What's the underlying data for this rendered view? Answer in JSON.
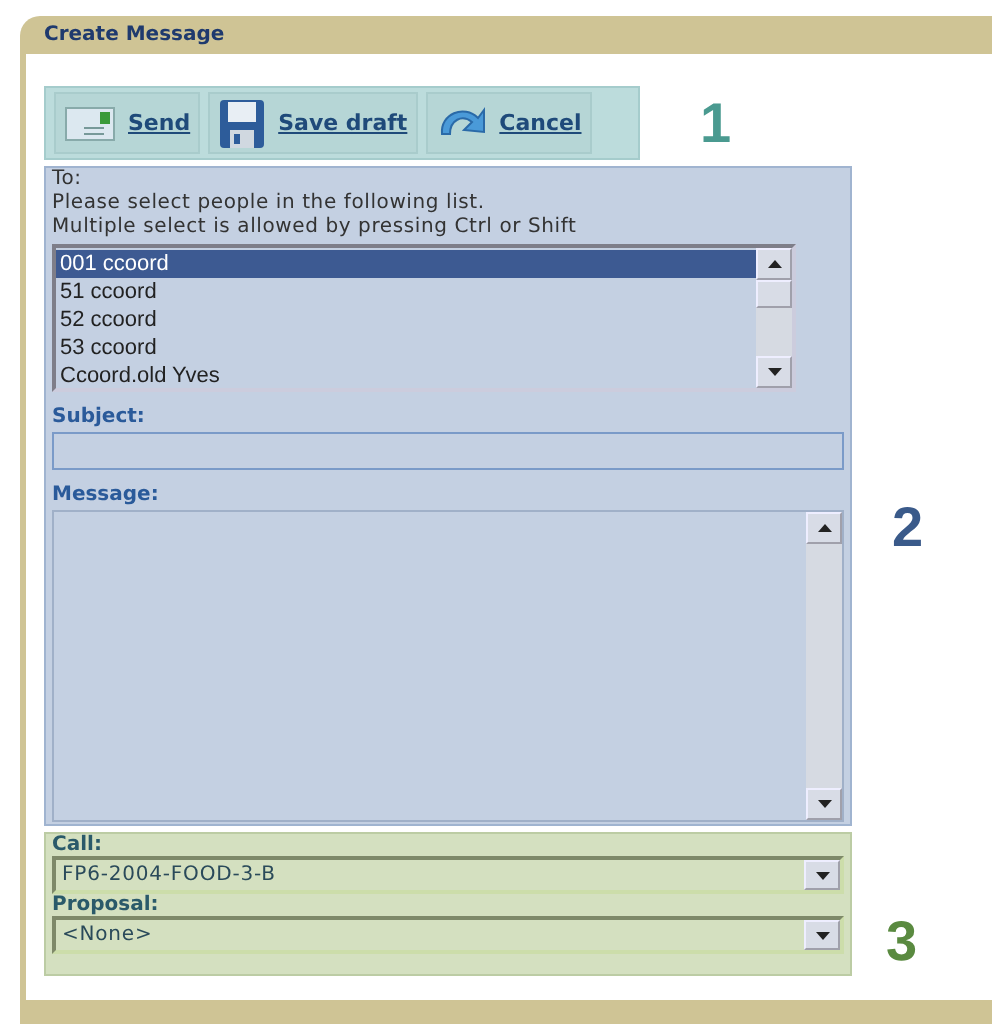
{
  "window": {
    "title": "Create Message"
  },
  "toolbar": {
    "buttons": [
      {
        "kind": "send",
        "label": "Send"
      },
      {
        "kind": "save",
        "label": "Save draft"
      },
      {
        "kind": "cancel",
        "label": "Cancel"
      }
    ],
    "marker": "1"
  },
  "recipients": {
    "label": "To:",
    "instructions": [
      "Please select people in the following list.",
      "Multiple select is allowed by pressing Ctrl or Shift"
    ],
    "items": [
      {
        "label": "001 ccoord",
        "selected": true
      },
      {
        "label": "51 ccoord",
        "selected": false
      },
      {
        "label": "52 ccoord",
        "selected": false
      },
      {
        "label": "53 ccoord",
        "selected": false
      },
      {
        "label": "Ccoord.old Yves",
        "selected": false
      }
    ]
  },
  "subject": {
    "label": "Subject:"
  },
  "message": {
    "label": "Message:"
  },
  "content_marker": "2",
  "filters": {
    "marker": "3",
    "fields": [
      {
        "label": "Call:",
        "value": "FP6-2004-FOOD-3-B"
      },
      {
        "label": "Proposal:",
        "value": "<None>"
      }
    ]
  }
}
